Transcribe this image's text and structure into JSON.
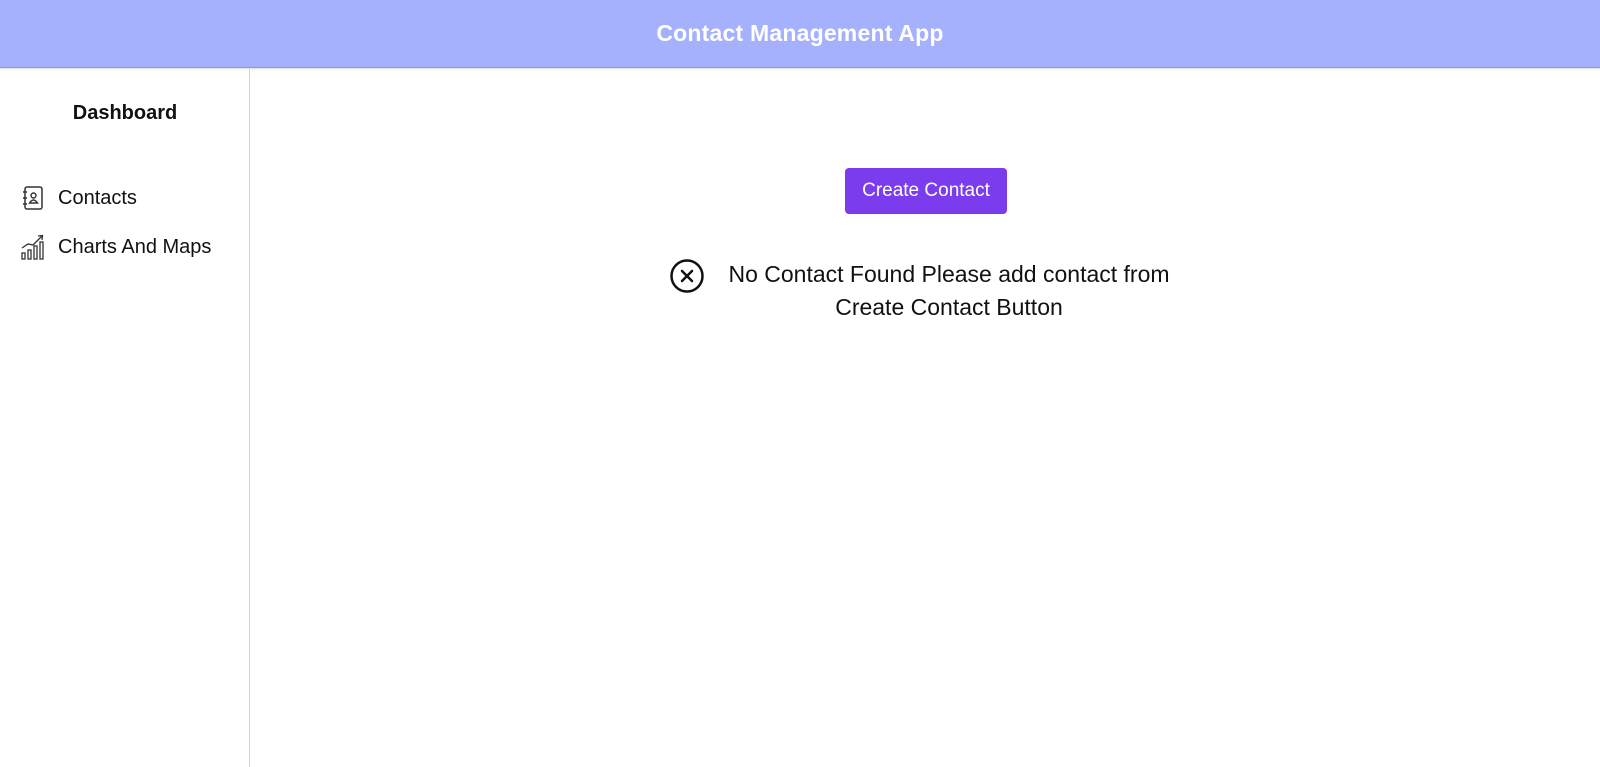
{
  "header": {
    "title": "Contact Management App",
    "background_color": "#a5b1fd"
  },
  "sidebar": {
    "heading": "Dashboard",
    "items": [
      {
        "label": "Contacts",
        "icon": "contact-book-icon"
      },
      {
        "label": "Charts And Maps",
        "icon": "chart-growth-icon"
      }
    ]
  },
  "main": {
    "create_button": {
      "label": "Create Contact",
      "color": "#7a3cec"
    },
    "empty_state": {
      "icon": "close-circle-icon",
      "message": "No Contact Found Please add contact from Create Contact Button"
    }
  }
}
